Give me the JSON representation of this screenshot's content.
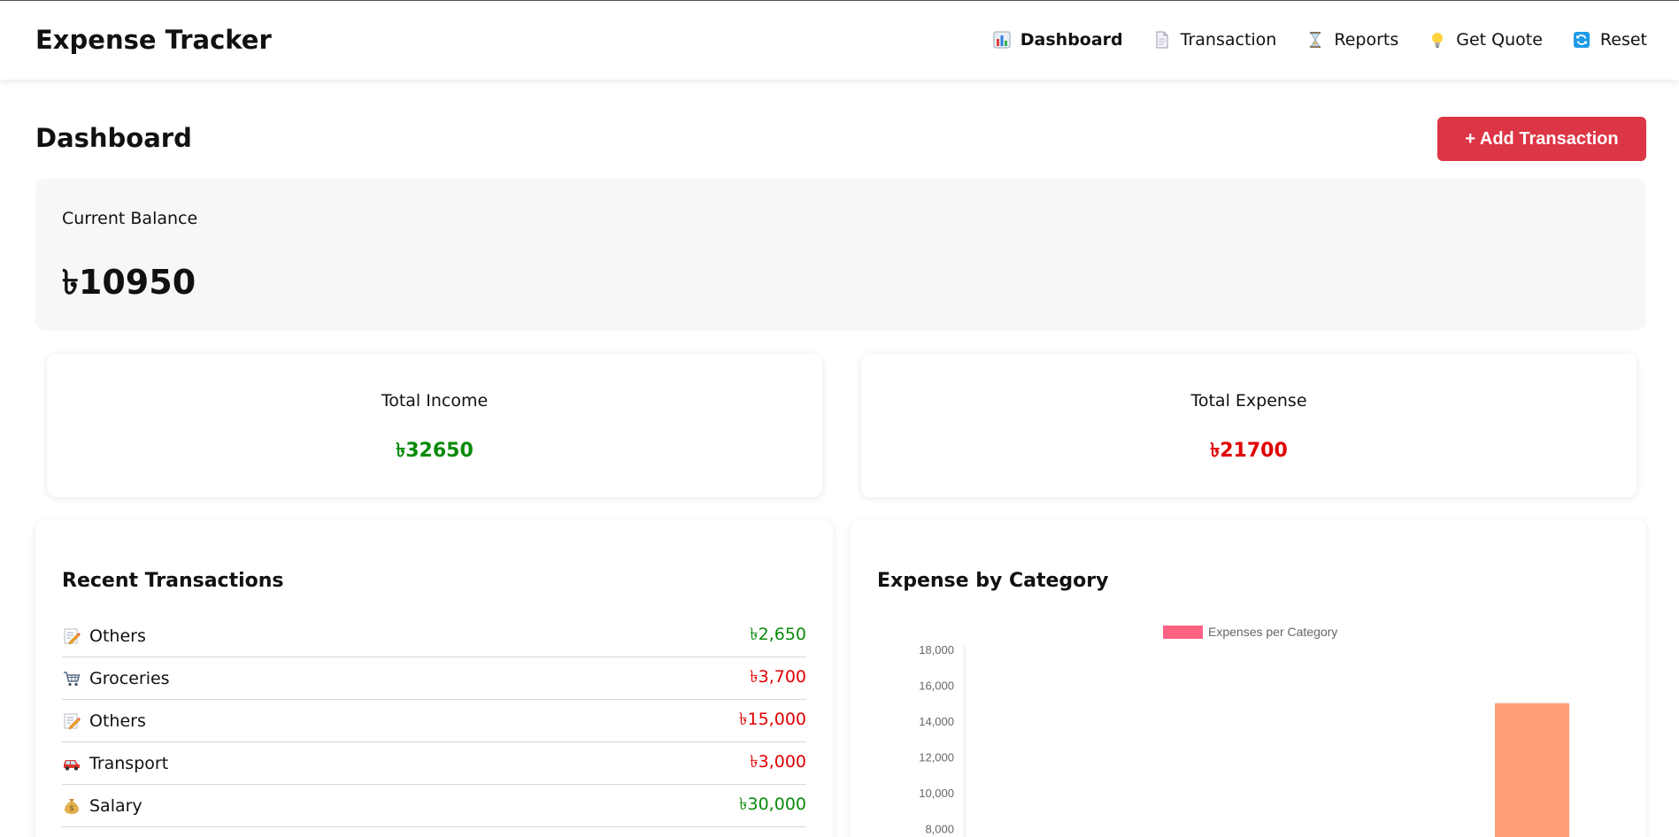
{
  "app": {
    "title": "Expense Tracker"
  },
  "nav": {
    "items": [
      {
        "label": "Dashboard",
        "icon": "bar-chart-icon",
        "active": true
      },
      {
        "label": "Transaction",
        "icon": "document-icon",
        "active": false
      },
      {
        "label": "Reports",
        "icon": "hourglass-icon",
        "active": false
      },
      {
        "label": "Get Quote",
        "icon": "lightbulb-icon",
        "active": false
      },
      {
        "label": "Reset",
        "icon": "refresh-icon",
        "active": false
      }
    ]
  },
  "page": {
    "title": "Dashboard",
    "add_button": "+ Add Transaction"
  },
  "balance": {
    "label": "Current Balance",
    "value": "৳10950"
  },
  "income": {
    "label": "Total Income",
    "value": "৳32650"
  },
  "expense": {
    "label": "Total Expense",
    "value": "৳21700"
  },
  "recent": {
    "title": "Recent Transactions",
    "items": [
      {
        "label": "Others",
        "icon": "memo-icon",
        "amount": "৳2,650",
        "type": "income"
      },
      {
        "label": "Groceries",
        "icon": "shopping-cart-icon",
        "amount": "৳3,700",
        "type": "expense"
      },
      {
        "label": "Others",
        "icon": "memo-icon",
        "amount": "৳15,000",
        "type": "expense"
      },
      {
        "label": "Transport",
        "icon": "car-icon",
        "amount": "৳3,000",
        "type": "expense"
      },
      {
        "label": "Salary",
        "icon": "money-bag-icon",
        "amount": "৳30,000",
        "type": "income"
      }
    ]
  },
  "colors": {
    "income": "#0a8a0a",
    "expense": "#e00000",
    "accent": "#dc3545",
    "legend": "#ff6384",
    "bar": "#ffa07a"
  },
  "chart_panel": {
    "title": "Expense by Category"
  },
  "chart_data": {
    "type": "bar",
    "legend": [
      "Expenses per Category"
    ],
    "legend_position": "top",
    "y_ticks": [
      "18,000",
      "16,000",
      "14,000",
      "12,000",
      "10,000",
      "8,000"
    ],
    "ylim": [
      8000,
      18000
    ],
    "series": [
      {
        "name": "Expenses per Category",
        "values": [
          15000
        ]
      }
    ],
    "grid": false
  }
}
